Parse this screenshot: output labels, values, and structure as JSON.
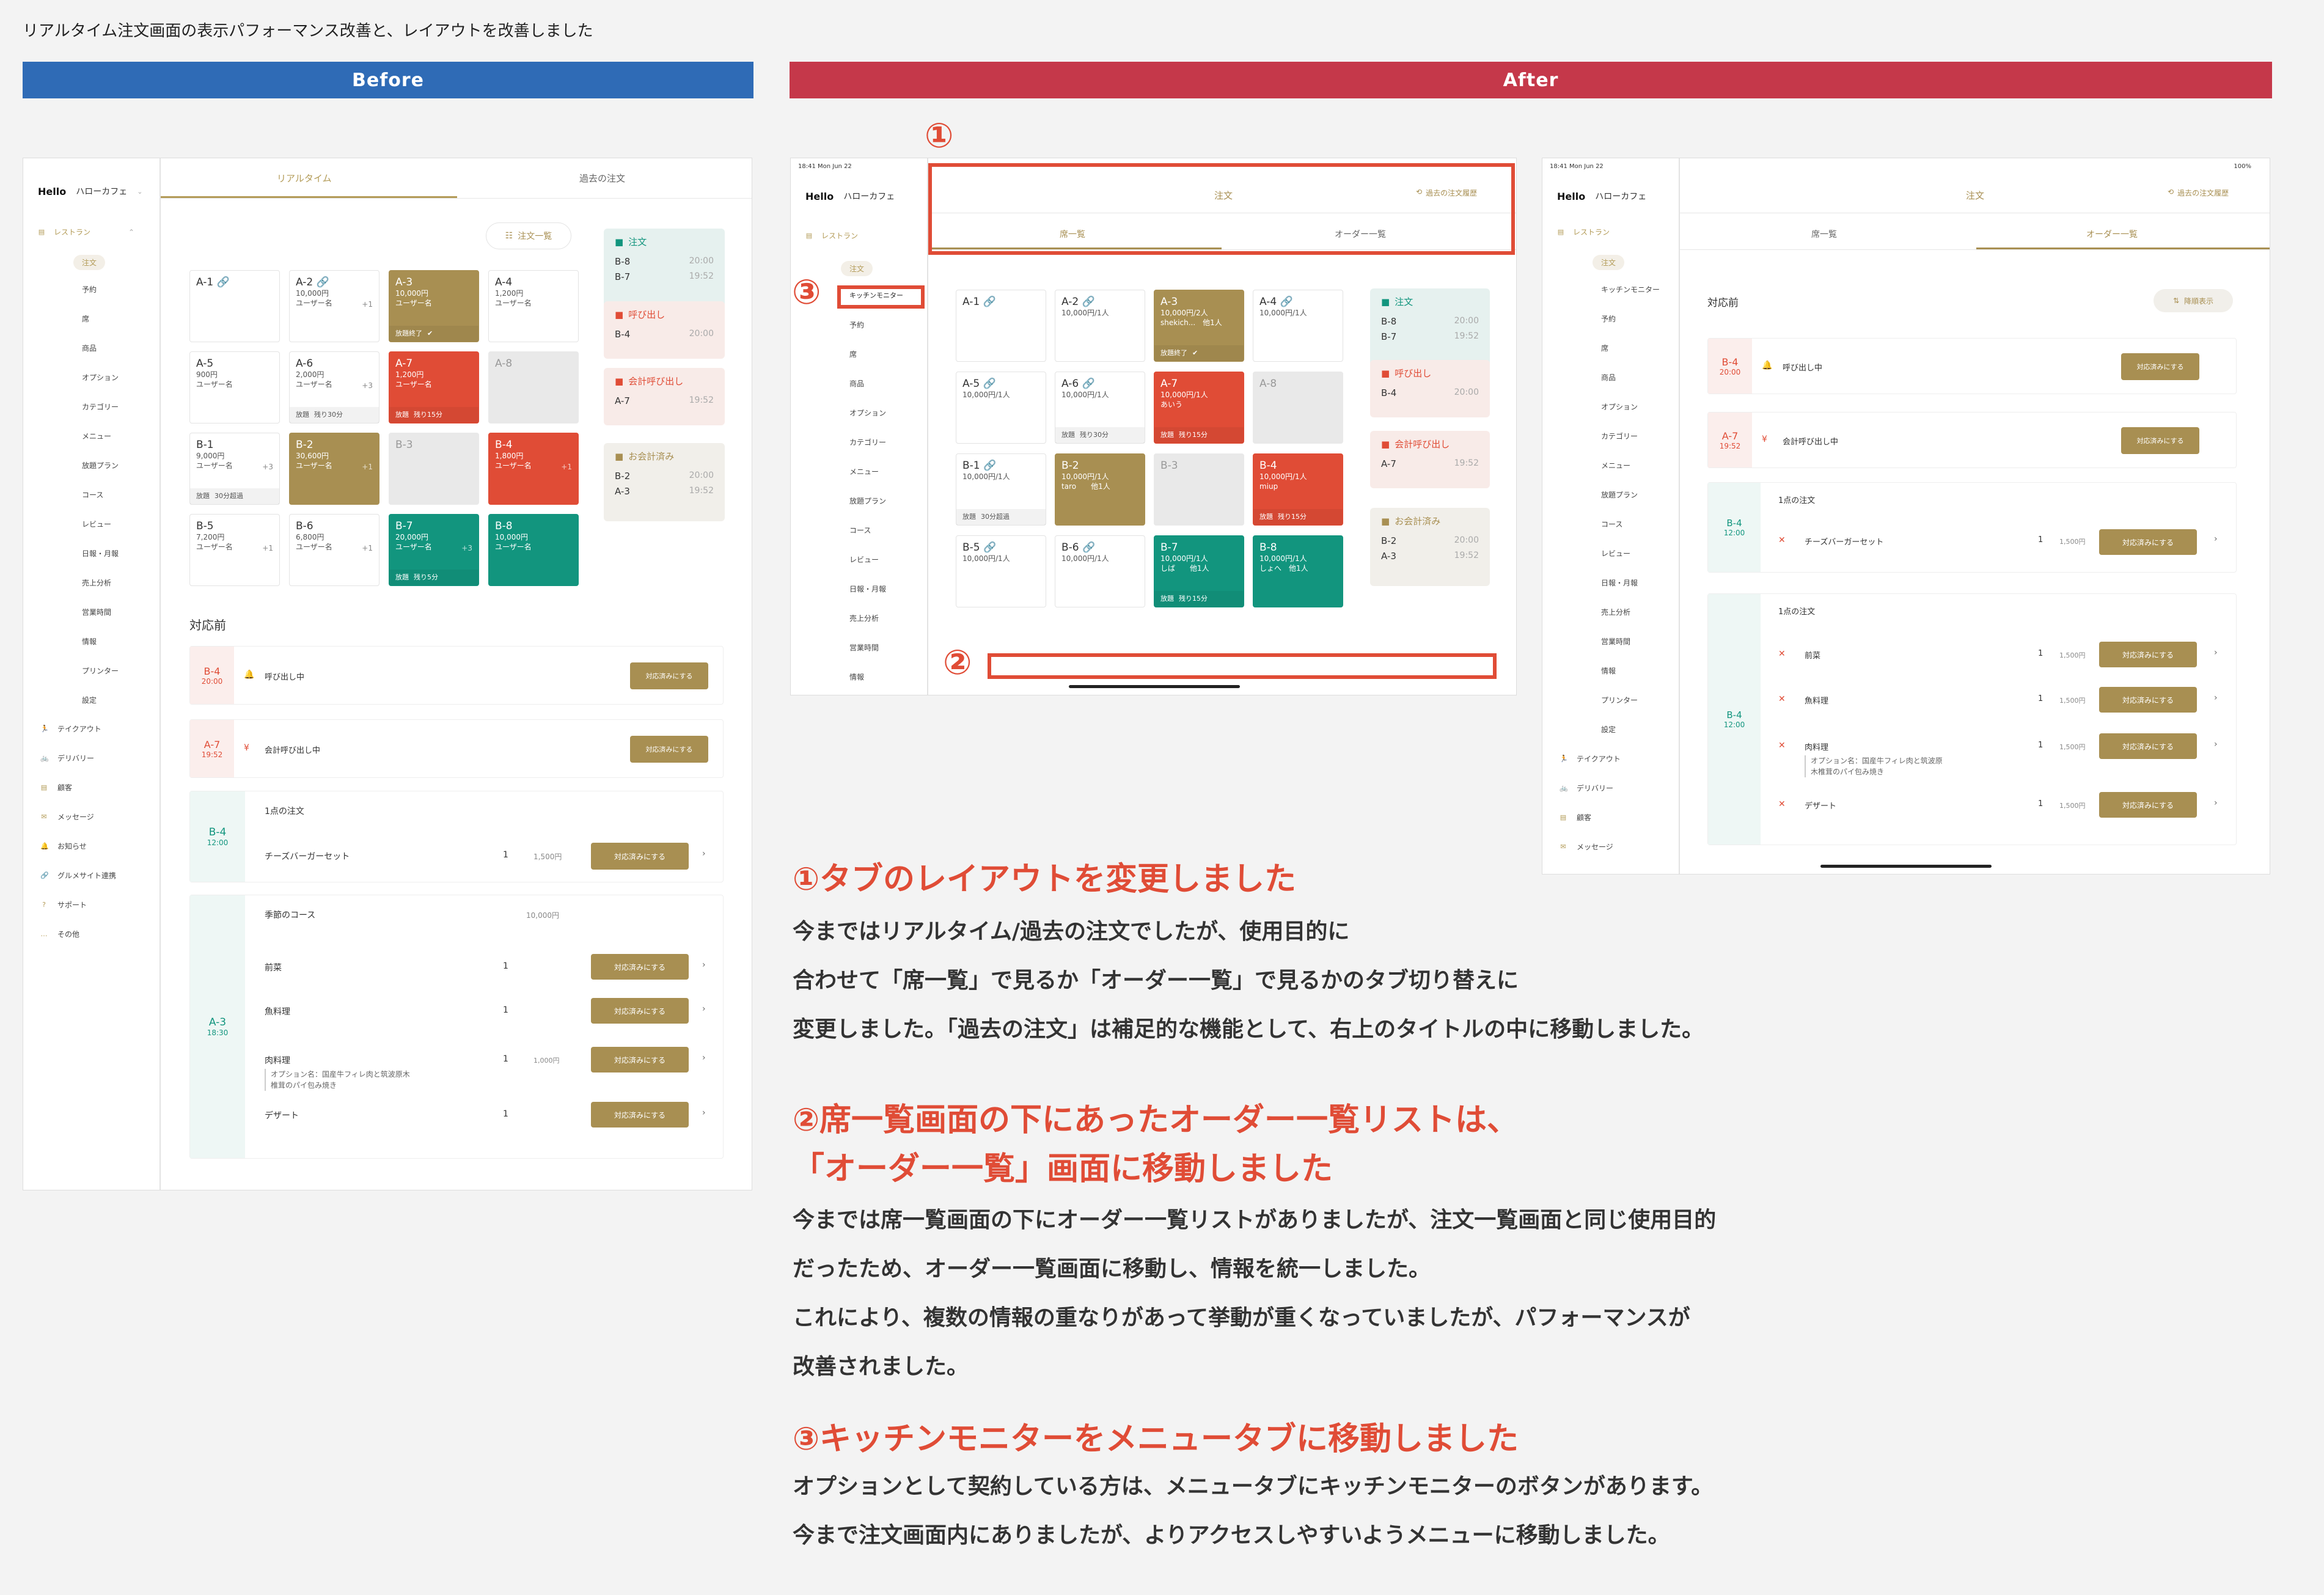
{
  "page_title": "リアルタイム注文画面の表示パフォーマンス改善と、レイアウトを改善しました",
  "colors": {
    "before": "#2f6bb6",
    "after": "#c5384a",
    "accent": "#a88f52",
    "red": "#e04c36",
    "teal": "#12957e"
  },
  "before_label": "Before",
  "after_label": "After",
  "app": {
    "brand": "Hello",
    "shop": "ハローカフェ",
    "restaurant_group": "レストラン",
    "menu_before": [
      "注文",
      "予約",
      "席",
      "商品",
      "オプション",
      "カテゴリー",
      "メニュー",
      "放題プラン",
      "コース",
      "レビュー",
      "日報・月報",
      "売上分析",
      "営業時間",
      "情報",
      "プリンター",
      "設定"
    ],
    "bottom_menu": [
      "テイクアウト",
      "デリバリー",
      "顧客",
      "メッセージ",
      "お知らせ",
      "グルメサイト連携",
      "サポート",
      "その他"
    ],
    "menu_after": [
      "注文",
      "キッチンモニター",
      "予約",
      "席",
      "商品",
      "オプション",
      "カテゴリー",
      "メニュー",
      "放題プラン",
      "コース",
      "レビュー",
      "日報・月報",
      "売上分析",
      "営業時間",
      "情報"
    ],
    "menu_after2": [
      "注文",
      "キッチンモニター",
      "予約",
      "席",
      "商品",
      "オプション",
      "カテゴリー",
      "メニュー",
      "放題プラン",
      "コース",
      "レビュー",
      "日報・月報",
      "売上分析",
      "営業時間",
      "情報",
      "プリンター",
      "設定"
    ],
    "bottom_menu2": [
      "テイクアウト",
      "デリバリー",
      "顧客",
      "メッセージ"
    ]
  },
  "before": {
    "tab_realtime": "リアルタイム",
    "tab_past": "過去の注文",
    "order_list_btn": "注文一覧",
    "seats": [
      {
        "name": "A-1 🔗",
        "l1": "",
        "l2": "",
        "foot": "",
        "style": "white"
      },
      {
        "name": "A-2 🔗",
        "l1": "10,000円",
        "l2": "ユーザー名",
        "plus": "+1",
        "foot": "",
        "style": "white"
      },
      {
        "name": "A-3",
        "l1": "10,000円",
        "l2": "ユーザー名",
        "foot": "放題終了",
        "foot2": "✔",
        "style": "gold"
      },
      {
        "name": "A-4",
        "l1": "1,200円",
        "l2": "ユーザー名",
        "foot": "",
        "style": "white"
      },
      {
        "name": "A-5",
        "l1": "900円",
        "l2": "ユーザー名",
        "foot": "",
        "style": "white"
      },
      {
        "name": "A-6",
        "l1": "2,000円",
        "l2": "ユーザー名",
        "plus": "+3",
        "foot": "放題",
        "foot2": "残り30分",
        "style": "white"
      },
      {
        "name": "A-7",
        "l1": "1,200円",
        "l2": "ユーザー名",
        "foot": "放題",
        "foot2": "残り15分",
        "style": "red"
      },
      {
        "name": "A-8",
        "l1": "",
        "l2": "",
        "foot": "",
        "style": "gray"
      },
      {
        "name": "B-1",
        "l1": "9,000円",
        "l2": "ユーザー名",
        "plus": "+3",
        "foot": "放題",
        "foot2": "30分超過",
        "style": "white"
      },
      {
        "name": "B-2",
        "l1": "30,600円",
        "l2": "ユーザー名",
        "plus": "+1",
        "foot": "",
        "style": "gold"
      },
      {
        "name": "B-3",
        "l1": "",
        "l2": "",
        "foot": "",
        "style": "gray"
      },
      {
        "name": "B-4",
        "l1": "1,800円",
        "l2": "ユーザー名",
        "plus": "+1",
        "foot": "",
        "style": "red"
      },
      {
        "name": "B-5",
        "l1": "7,200円",
        "l2": "ユーザー名",
        "plus": "+1",
        "foot": "",
        "style": "white"
      },
      {
        "name": "B-6",
        "l1": "6,800円",
        "l2": "ユーザー名",
        "plus": "+1",
        "foot": "",
        "style": "white"
      },
      {
        "name": "B-7",
        "l1": "20,000円",
        "l2": "ユーザー名",
        "plus": "+3",
        "foot": "放題",
        "foot2": "残り5分",
        "style": "teal"
      },
      {
        "name": "B-8",
        "l1": "10,000円",
        "l2": "ユーザー名",
        "foot": "",
        "style": "teal"
      }
    ],
    "status": [
      {
        "title": "注文",
        "rows": [
          [
            "B-8",
            "20:00"
          ],
          [
            "B-7",
            "19:52"
          ]
        ],
        "bg": "#e6f1ef",
        "color": "#12957e"
      },
      {
        "title": "呼び出し",
        "rows": [
          [
            "B-4",
            "20:00"
          ]
        ],
        "bg": "#f8ebe8",
        "color": "#e04c36"
      },
      {
        "title": "会計呼び出し",
        "rows": [
          [
            "A-7",
            "19:52"
          ]
        ],
        "bg": "#f8ebe8",
        "color": "#e04c36"
      },
      {
        "title": "お会計済み",
        "rows": [
          [
            "B-2",
            "20:00"
          ],
          [
            "A-3",
            "19:52"
          ]
        ],
        "bg": "#f1efea",
        "color": "#a88f52"
      }
    ],
    "pending_title": "対応前",
    "call_rows": [
      {
        "seat": "B-4",
        "time": "20:00",
        "icon": "🔔",
        "text": "呼び出し中",
        "btn": "対応済みにする"
      },
      {
        "seat": "A-7",
        "time": "19:52",
        "icon": "¥",
        "text": "会計呼び出し中",
        "btn": "対応済みにする"
      }
    ],
    "order1": {
      "seat": "B-4",
      "time": "12:00",
      "head": "1点の注文",
      "item": "チーズバーガーセット",
      "qty": "1",
      "price": "1,500円",
      "btn": "対応済みにする"
    },
    "order2": {
      "seat": "A-3",
      "time": "18:30",
      "head": "季節のコース",
      "head_price": "10,000円",
      "items": [
        {
          "name": "前菜",
          "qty": "1",
          "price": "",
          "btn": "対応済みにする"
        },
        {
          "name": "魚料理",
          "qty": "1",
          "price": "",
          "btn": "対応済みにする"
        },
        {
          "name": "肉料理",
          "qty": "1",
          "price": "1,000円",
          "btn": "対応済みにする",
          "opt1": "オプション名：国産牛フィレ肉と筑波原木",
          "opt2": "椎茸のパイ包み焼き"
        },
        {
          "name": "デザート",
          "qty": "1",
          "price": "",
          "btn": "対応済みにする"
        }
      ]
    }
  },
  "after1": {
    "status_time": "18:41 Mon Jun 22",
    "title": "注文",
    "history": "過去の注文履歴",
    "tab_seats": "席一覧",
    "tab_orders": "オーダー一覧",
    "seats": [
      {
        "name": "A-1 🔗",
        "l1": "",
        "l2": "",
        "style": "white"
      },
      {
        "name": "A-2 🔗",
        "l1": "10,000円/1人",
        "l2": "",
        "style": "white"
      },
      {
        "name": "A-3",
        "l1": "10,000円/2人",
        "l2": "shekich...　他1人",
        "foot": "放題終了",
        "foot2": "✔",
        "style": "gold"
      },
      {
        "name": "A-4 🔗",
        "l1": "10,000円/1人",
        "l2": "",
        "style": "white"
      },
      {
        "name": "A-5 🔗",
        "l1": "10,000円/1人",
        "l2": "",
        "style": "white"
      },
      {
        "name": "A-6 🔗",
        "l1": "10,000円/1人",
        "l2": "",
        "foot": "放題",
        "foot2": "残り30分",
        "style": "white"
      },
      {
        "name": "A-7",
        "l1": "10,000円/1人",
        "l2": "あいう",
        "foot": "放題",
        "foot2": "残り15分",
        "style": "red"
      },
      {
        "name": "A-8",
        "l1": "",
        "l2": "",
        "style": "gray"
      },
      {
        "name": "B-1 🔗",
        "l1": "10,000円/1人",
        "l2": "",
        "foot": "放題",
        "foot2": "30分超過",
        "style": "white"
      },
      {
        "name": "B-2",
        "l1": "10,000円/1人",
        "l2": "taro　　他1人",
        "style": "gold"
      },
      {
        "name": "B-3",
        "l1": "",
        "l2": "",
        "style": "gray"
      },
      {
        "name": "B-4",
        "l1": "10,000円/1人",
        "l2": "miup",
        "foot": "放題",
        "foot2": "残り15分",
        "style": "red"
      },
      {
        "name": "B-5 🔗",
        "l1": "10,000円/1人",
        "l2": "",
        "style": "white"
      },
      {
        "name": "B-6 🔗",
        "l1": "10,000円/1人",
        "l2": "",
        "style": "white"
      },
      {
        "name": "B-7",
        "l1": "10,000円/1人",
        "l2": "しば　　他1人",
        "foot": "放題",
        "foot2": "残り15分",
        "style": "teal"
      },
      {
        "name": "B-8",
        "l1": "10,000円/1人",
        "l2": "しょへ　他1人",
        "style": "teal"
      }
    ],
    "status": [
      {
        "title": "注文",
        "rows": [
          [
            "B-8",
            "20:00"
          ],
          [
            "B-7",
            "19:52"
          ]
        ],
        "bg": "#e6f1ef",
        "color": "#12957e"
      },
      {
        "title": "呼び出し",
        "rows": [
          [
            "B-4",
            "20:00"
          ]
        ],
        "bg": "#f8ebe8",
        "color": "#e04c36"
      },
      {
        "title": "会計呼び出し",
        "rows": [
          [
            "A-7",
            "19:52"
          ]
        ],
        "bg": "#f8ebe8",
        "color": "#e04c36"
      },
      {
        "title": "お会計済み",
        "rows": [
          [
            "B-2",
            "20:00"
          ],
          [
            "A-3",
            "19:52"
          ]
        ],
        "bg": "#f1efea",
        "color": "#a88f52"
      }
    ],
    "markers": [
      "①",
      "②",
      "③"
    ]
  },
  "after2": {
    "status_time": "18:41 Mon Jun 22",
    "battery": "100%",
    "title": "注文",
    "history": "過去の注文履歴",
    "tab_seats": "席一覧",
    "tab_orders": "オーダー一覧",
    "pending_title": "対応前",
    "sort": "降順表示",
    "call_rows": [
      {
        "seat": "B-4",
        "time": "20:00",
        "icon": "🔔",
        "text": "呼び出し中",
        "btn": "対応済みにする"
      },
      {
        "seat": "A-7",
        "time": "19:52",
        "icon": "¥",
        "text": "会計呼び出し中",
        "btn": "対応済みにする"
      }
    ],
    "order1": {
      "seat": "B-4",
      "time": "12:00",
      "head": "1点の注文",
      "item": "チーズバーガーセット",
      "qty": "1",
      "price": "1,500円",
      "btn": "対応済みにする"
    },
    "order2": {
      "seat": "B-4",
      "time": "12:00",
      "head": "1点の注文",
      "items": [
        {
          "name": "前菜",
          "qty": "1",
          "price": "1,500円",
          "btn": "対応済みにする"
        },
        {
          "name": "魚料理",
          "qty": "1",
          "price": "1,500円",
          "btn": "対応済みにする"
        },
        {
          "name": "肉料理",
          "qty": "1",
          "price": "1,500円",
          "btn": "対応済みにする",
          "opt1": "オプション名：国産牛フィレ肉と筑波原",
          "opt2": "木椎茸のパイ包み焼き"
        },
        {
          "name": "デザート",
          "qty": "1",
          "price": "1,500円",
          "btn": "対応済みにする"
        }
      ]
    }
  },
  "notes": [
    {
      "heading": "①タブのレイアウトを変更しました",
      "lines": [
        "今まではリアルタイム/過去の注文でしたが、使用目的に",
        "合わせて「席一覧」で見るか「オーダー一覧」で見るかのタブ切り替えに",
        "変更しました。「過去の注文」は補足的な機能として、右上のタイトルの中に移動しました。"
      ]
    },
    {
      "heading": "②席一覧画面の下にあったオーダー一覧リストは、",
      "heading2": "「オーダー一覧」画面に移動しました",
      "lines": [
        "今までは席一覧画面の下にオーダー一覧リストがありましたが、注文一覧画面と同じ使用目的",
        "だったため、オーダー一覧画面に移動し、情報を統一しました。",
        "これにより、複数の情報の重なりがあって挙動が重くなっていましたが、パフォーマンスが",
        "改善されました。"
      ]
    },
    {
      "heading": "③キッチンモニターをメニュータブに移動しました",
      "lines": [
        "オプションとして契約している方は、メニュータブにキッチンモニターのボタンがあります。",
        "今まで注文画面内にありましたが、よりアクセスしやすいようメニューに移動しました。"
      ]
    }
  ]
}
